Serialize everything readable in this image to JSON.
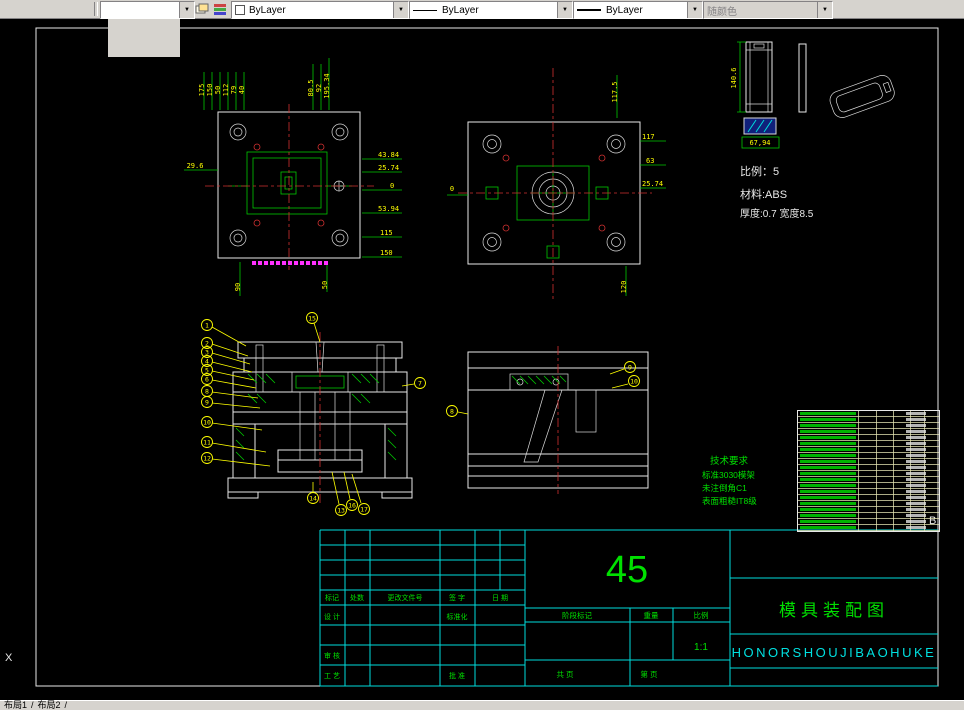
{
  "icons": {
    "chevron_down": "▼"
  },
  "toolbar": {
    "color": {
      "value": "ByLayer"
    },
    "linetype": {
      "value": "ByLayer"
    },
    "lineweight": {
      "value": "ByLayer"
    },
    "plotstyle": {
      "value": "随颜色"
    }
  },
  "statusbar": {
    "tab1": "布局1",
    "tab2": "布局2",
    "sep": "/"
  },
  "canvas": {
    "ucs_x": "X",
    "zone_b": "B"
  },
  "view_tl": {
    "top_dims": [
      "175",
      "150",
      "50",
      "112",
      "79",
      "40"
    ],
    "top_dims_right": [
      "80.5",
      "92",
      "195.34"
    ],
    "left_dim": "29.6",
    "right_dims": [
      "43.84",
      "25.74",
      "0",
      "53.94",
      "115",
      "150"
    ],
    "bottom_dims": [
      "90",
      "50"
    ]
  },
  "view_tm": {
    "top_dim": "117.5",
    "left_dim": "0",
    "right_dims": [
      "117",
      "63",
      "25.74"
    ],
    "bottom_dim": "120"
  },
  "view_part": {
    "height_dim": "140.6",
    "width_dim": "67,94",
    "scale_note": "比例：5",
    "material_note": "材料:ABS",
    "thickness_note": "厚度:0.7 宽度8.5"
  },
  "view_section_left": {
    "balloons_left": [
      "1",
      "2",
      "3",
      "4",
      "5",
      "6",
      "8",
      "9",
      "10",
      "11",
      "12"
    ],
    "balloon_top": "15",
    "balloon_right": "7",
    "balloons_bottom": [
      "14",
      "13",
      "16",
      "17"
    ]
  },
  "view_section_right": {
    "balloon_left": "8",
    "balloon_r1": "9",
    "balloon_r2": "10"
  },
  "tech_req": {
    "title": "技术要求",
    "line1": "标准3030模架",
    "line2": "未注倒角C1",
    "line3": "表面粗糙IT8级"
  },
  "title_block": {
    "part_no": "45",
    "headers": {
      "mark": "标记",
      "count": "处数",
      "doc_no": "更改文件号",
      "sign": "签 字",
      "date": "日 期"
    },
    "design": "设 计",
    "standardize": "标准化",
    "review": "审 核",
    "process": "工 艺",
    "approve": "批 准",
    "stage_mark": "阶段标记",
    "weight": "重量",
    "scale_label": "比例",
    "scale_value": "1:1",
    "sheet_total": "共 页",
    "sheet_no": "第 页",
    "drawing_title": "模具装配图",
    "company": "HONORSHOUJIBAOHUKE"
  }
}
